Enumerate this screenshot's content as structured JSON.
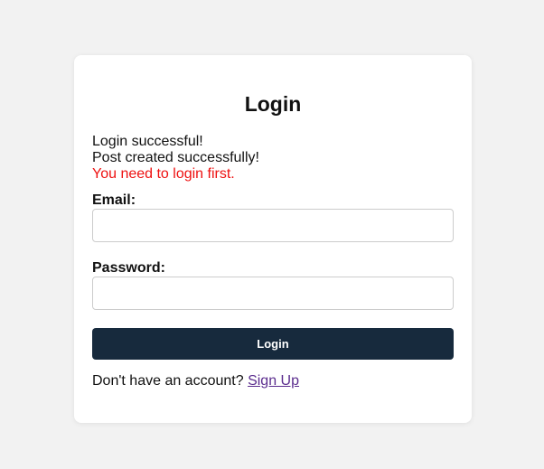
{
  "page": {
    "title": "Login"
  },
  "messages": {
    "success_login": "Login successful!",
    "success_post": "Post created successfully!",
    "error": "You need to login first."
  },
  "form": {
    "email_label": "Email:",
    "email_value": "",
    "password_label": "Password:",
    "password_value": "",
    "submit_label": "Login"
  },
  "footer": {
    "prompt": "Don't have an account?",
    "signup_label": "Sign Up"
  },
  "colors": {
    "background": "#f2f2f2",
    "card": "#ffffff",
    "button": "#172a3d",
    "error": "#ee1111",
    "link": "#5b2d8e"
  }
}
